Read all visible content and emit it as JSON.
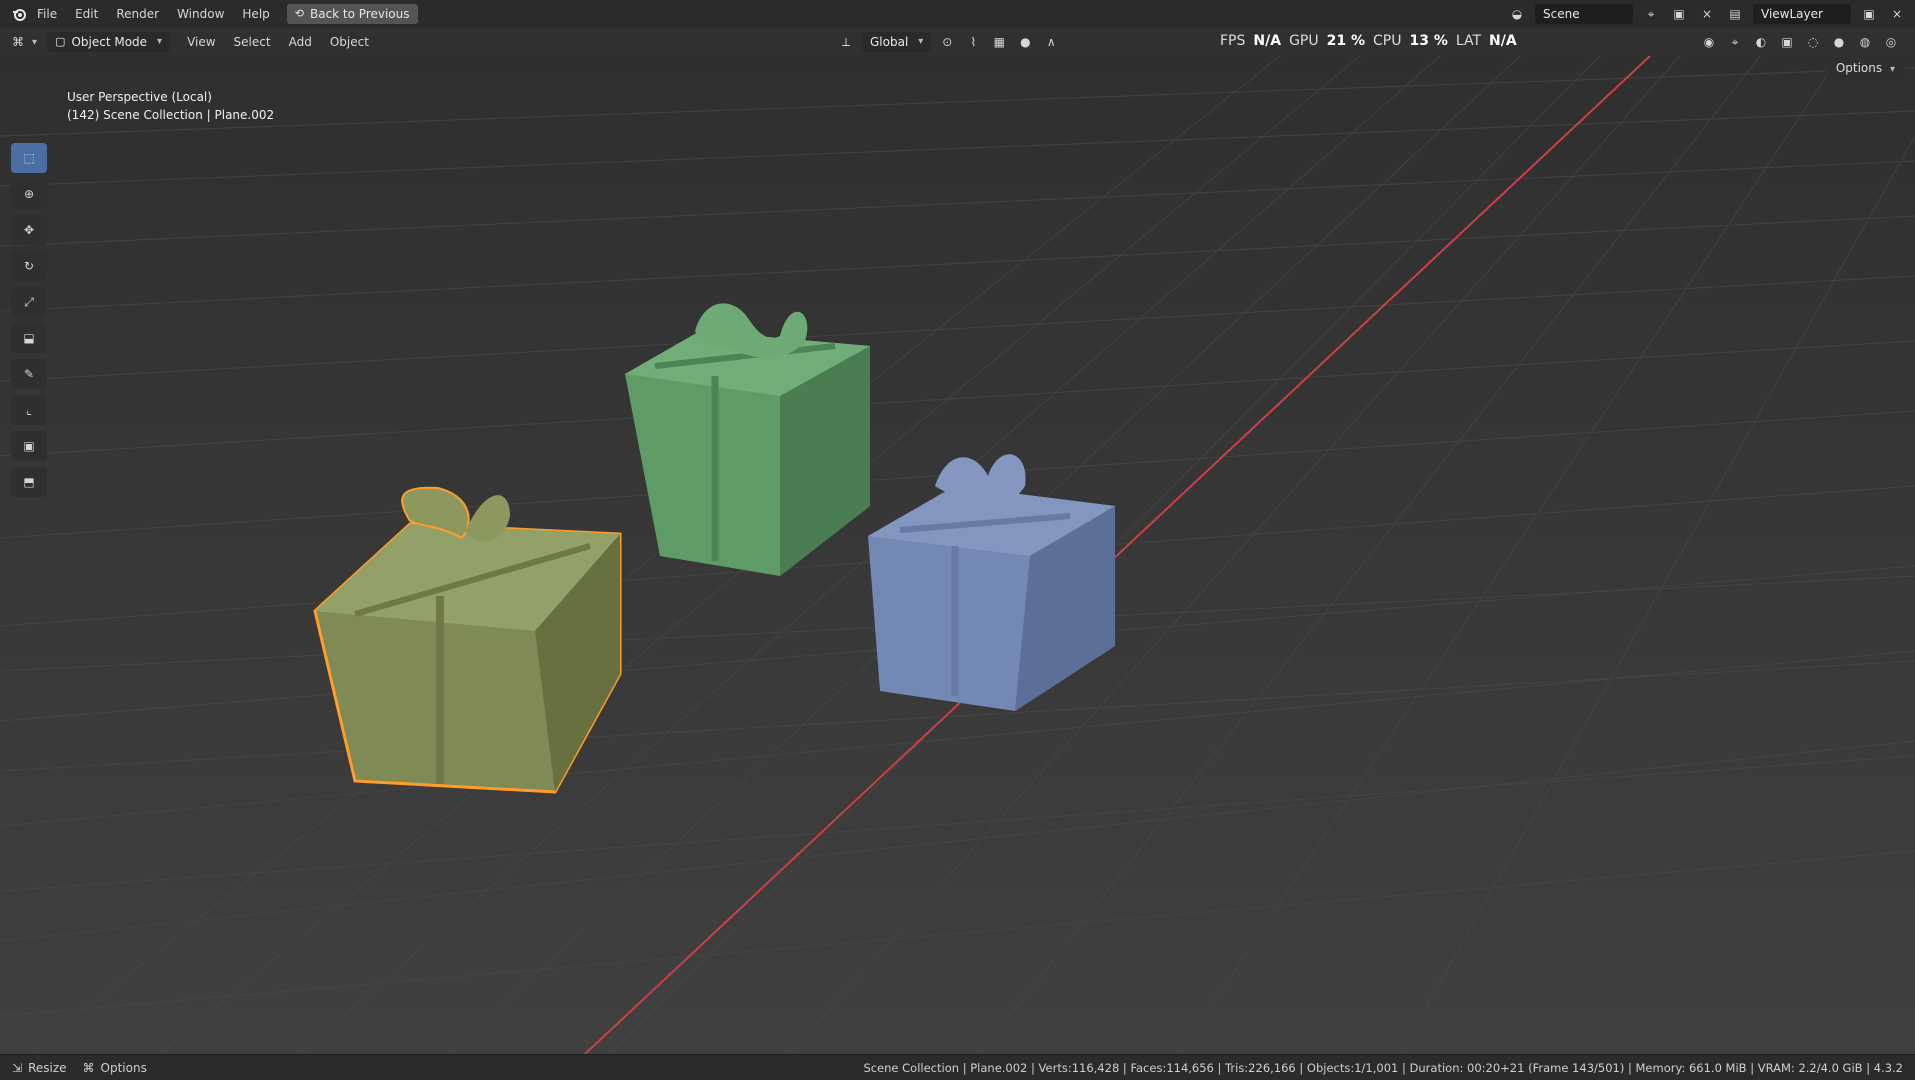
{
  "menu": {
    "items": [
      {
        "label": "File"
      },
      {
        "label": "Edit"
      },
      {
        "label": "Render"
      },
      {
        "label": "Window"
      },
      {
        "label": "Help"
      }
    ],
    "back_button": "Back to Previous"
  },
  "header": {
    "mode": "Object Mode",
    "menus": [
      "View",
      "Select",
      "Add",
      "Object"
    ],
    "transform": "Global",
    "stats": {
      "fps_label": "FPS",
      "fps_value": "N/A",
      "gpu_label": "GPU",
      "gpu_value": "21 %",
      "cpu_label": "CPU",
      "cpu_value": "13 %",
      "lat_label": "LAT",
      "lat_value": "N/A"
    },
    "scene": "Scene",
    "viewlayer": "ViewLayer",
    "options": "Options"
  },
  "viewport": {
    "overlay_line1": "User Perspective (Local)",
    "overlay_line2": "(142) Scene Collection | Plane.002"
  },
  "statusbar": {
    "left": [
      {
        "label": "Resize"
      },
      {
        "label": "Options"
      }
    ],
    "right": "Scene Collection | Plane.002 | Verts:116,428 | Faces:114,656 | Tris:226,166 | Objects:1/1,001 | Duration: 00:20+21 (Frame 143/501) | Memory: 661.0 MiB | VRAM: 2.2/4.0 GiB | 4.3.2"
  },
  "colors": {
    "grid": "#474747",
    "red_axis": "#cc3f45",
    "green_box": "#7f8a55",
    "green_box_dark": "#66713f",
    "green_box_light": "#93a067",
    "mint_box": "#5e9b66",
    "mint_box_dark": "#4a7e52",
    "blue_box": "#7388b3",
    "blue_box_dark": "#5c6f98",
    "selection": "#ff9c2a"
  }
}
